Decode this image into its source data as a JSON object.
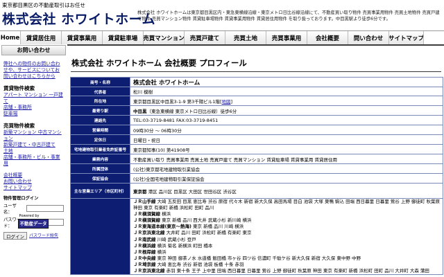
{
  "header": {
    "tagline": "東京都目黒区の不動産取引はお任せ",
    "logo": "株式会社 ホワイトホーム",
    "description": "株式会社 ホワイトホームは東京都目黒区内・東急東横線沿線・東京メトロ日比谷線沿線にて、不動産買い取り物件 売買事業用物件 売買土地物件 売買戸建て物件 売買マンション物件 賃貸駐車場物件 賃貸事業用物件 賃貸居住用物件 を取り扱っております。中目黒駅より徒歩6分です。"
  },
  "nav": [
    {
      "label": "Home"
    },
    {
      "label": "賃貸居住用"
    },
    {
      "label": "賃貸事業用"
    },
    {
      "label": "賃貸駐車場"
    },
    {
      "label": "売買マンション"
    },
    {
      "label": "売買戸建て"
    },
    {
      "label": "売買土地"
    },
    {
      "label": "売買事業用"
    },
    {
      "label": "会社概要"
    },
    {
      "label": "問い合わせ"
    },
    {
      "label": "サイトマップ"
    }
  ],
  "sidebar": {
    "contact_title": "お問い合わせ",
    "intro": "弊社への物件のお問い合わせや、サービスについてお問い合わせはこちらから",
    "rental_head": "賃貸物件検索",
    "rental_links": [
      "アパート マンション 一戸建て",
      "店舗・事務所",
      "駐車場"
    ],
    "sale_head": "売買物件検索",
    "sale_links": [
      "新築マンション 中古マンション",
      "新築戸建て・中古戸建て",
      "土地",
      "店舗・事務所・ビル・事業用"
    ],
    "other_links": [
      "会社概要",
      "お問い合わせ",
      "サイトマップ"
    ],
    "login": {
      "title": "物件管理ログイン",
      "user_label": "ユーザ名：",
      "pass_label": "パスワード：",
      "button": "ログイン",
      "forgot": "パスワード紛失"
    },
    "powered_by": "Powered by",
    "badge": "不動産データ"
  },
  "main": {
    "title": "株式会社 ホワイトホーム 会社概要 プロフィール",
    "rows": [
      {
        "key": "商号・名称",
        "value": "株式会社 ホワイトホーム"
      },
      {
        "key": "代表者",
        "value": "松川 模樹"
      },
      {
        "key": "所在地",
        "value": "東京都目黒区中目黒3-1-9 第3千陽ビル1階",
        "link": "地図"
      },
      {
        "key": "最寄り駅",
        "value_bold": "中目黒",
        "value": "（東急東横線 東京メトロ日比谷線）徒歩6分"
      },
      {
        "key": "連絡先",
        "value": "TEL:03-3719-8481 FAX:03-3719-8451"
      },
      {
        "key": "営業時間",
        "value": "09時30分 ～ 06時30分"
      },
      {
        "key": "定休日",
        "value": "日曜日・祝日"
      },
      {
        "key": "宅地建物取引業者免許証番号",
        "value": "東京都知事(10) 第41908号"
      },
      {
        "key": "業務内容",
        "value": "不動産買い取り 売買事業用 売買土地 売買戸建て 売買マンション 賃貸駐車場 賃貸事業用 賃貸居住用"
      },
      {
        "key": "所属団体",
        "value": "(公社)東京都宅地建物取引業協会"
      },
      {
        "key": "保証協会",
        "value": "(公社)全国宅地建物取引業保証協会"
      },
      {
        "key": "主な営業エリア（市区町村）",
        "value_bold": "東京都",
        "value": "港区 品川区 目黒区 大田区 世田谷区 渋谷区"
      }
    ],
    "lines_key": "",
    "lines": [
      {
        "name": "ＪＲ山手線",
        "stations": "大崎 五反田 目黒 恵比寿 渋谷 原宿 代々木 新宿 新大久保 高田馬場 目白 池袋 大塚 巣鴨 駒込 田端 西日暮里 日暮里 鶯谷 上野 御徒町 秋葉原 神田 東京 有楽町 新橋 浜松町 田町 品川"
      },
      {
        "name": "ＪＲ横須賀線",
        "stations": "横浜"
      },
      {
        "name": "ＪＲ横須賀線",
        "stations": "東京 新橋 品川 西大井 武蔵小杉 新川崎 横浜"
      },
      {
        "name": "ＪＲ東海道本線(東京～熱海)",
        "stations": "東京 新橋 品川 川崎 横浜"
      },
      {
        "name": "ＪＲ京浜東北線",
        "stations": "大井町 品川 田町 浜松町 新橋 有楽町 東京"
      },
      {
        "name": "ＪＲ南武線",
        "stations": "川崎 武蔵小杉 登戸"
      },
      {
        "name": "ＪＲ横浜線",
        "stations": "横浜 菊名 新横浜 町田 橋本"
      },
      {
        "name": "ＪＲ根岸線",
        "stations": "横浜"
      },
      {
        "name": "ＪＲ中央線",
        "stations": "東京 神田 御茶ノ水 水道橋 飯田橋 市ヶ谷 四ツ谷 信濃町 千駄ケ谷 新大久保 新宿 大久保 東中野 中野"
      },
      {
        "name": "ＪＲ埼京線",
        "stations": "大崎 恵比寿 渋谷 新宿 池袋 板橋 十条 赤羽"
      },
      {
        "name": "ＪＲ京浜東北線",
        "stations": "赤羽 東十条 王子 上中里 田端 西日暮里 日暮里 鶯谷 上野 御徒町 秋葉原 神田 東京 有楽町 新橋 浜松町 田町 品川 大井町 大森 蒲田"
      }
    ]
  }
}
